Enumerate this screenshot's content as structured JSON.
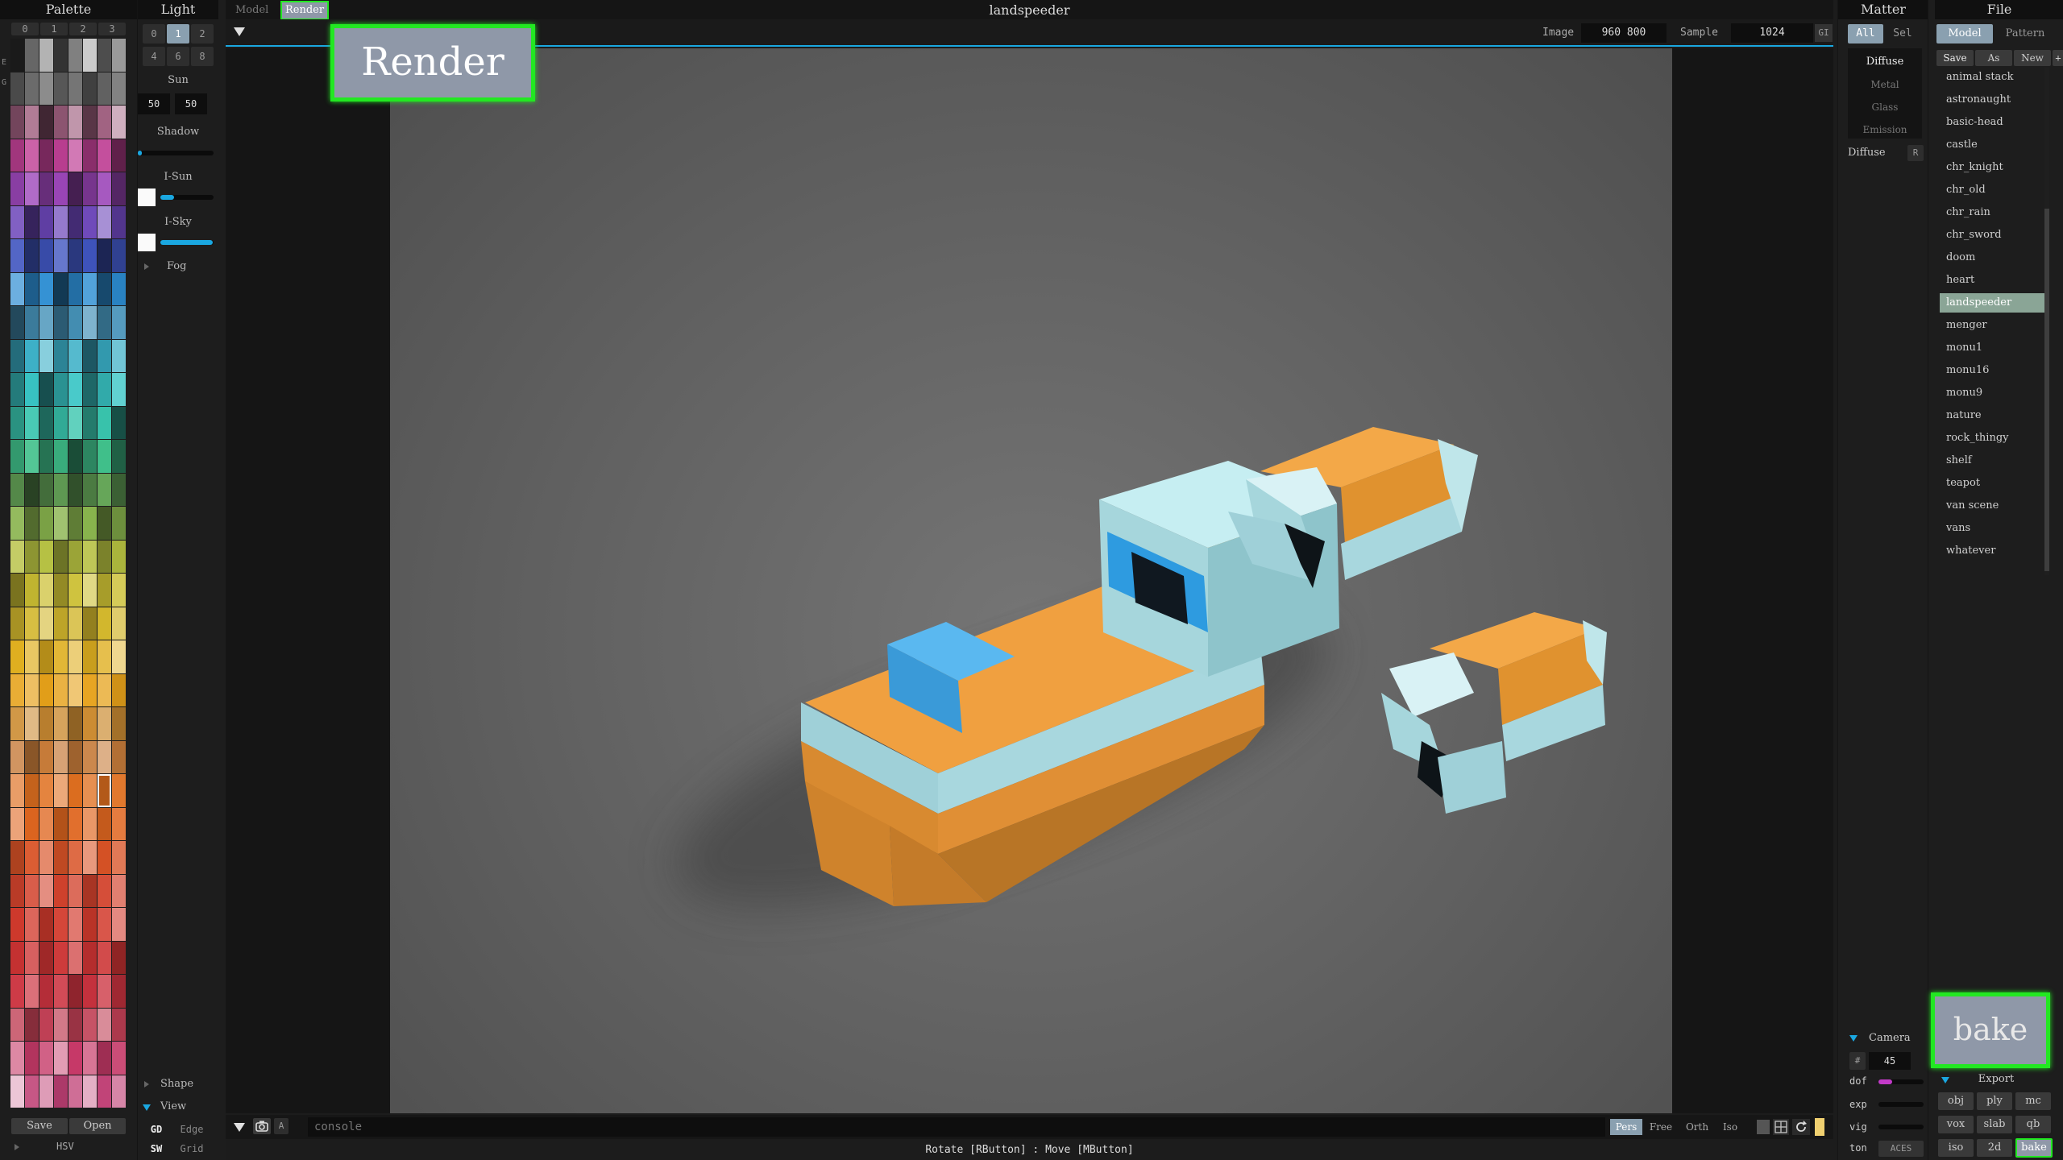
{
  "topbar": {
    "tab_model": "Model",
    "tab_render": "Render",
    "title": "landspeeder",
    "image_label": "Image",
    "image_size": "960 800",
    "sample_label": "Sample",
    "sample_value": "1024",
    "gi_label": "GI"
  },
  "palette": {
    "title": "Palette",
    "tabs": [
      "0",
      "1",
      "2",
      "3"
    ],
    "side_letters": [
      "E",
      "G"
    ],
    "save": "Save",
    "open": "Open",
    "mode": "HSV"
  },
  "light": {
    "title": "Light",
    "presets": [
      "0",
      "1",
      "2",
      "4",
      "6",
      "8"
    ],
    "sun_label": "Sun",
    "sun_values": [
      "50",
      "50"
    ],
    "shadow_label": "Shadow",
    "shadow_level": 0.05,
    "isun_label": "I-Sun",
    "isun_level": 0.25,
    "isky_label": "I-Sky",
    "isky_level": 0.98,
    "fog_label": "Fog",
    "shape_label": "Shape",
    "view_label": "View",
    "view_rows": [
      [
        "GD",
        "Edge"
      ],
      [
        "SW",
        "Grid"
      ]
    ]
  },
  "matter": {
    "title": "Matter",
    "tabs": [
      "All",
      "Sel"
    ],
    "types": [
      "Diffuse",
      "Metal",
      "Glass",
      "Emission"
    ],
    "current_label": "Diffuse",
    "current_btn": "R",
    "camera_label": "Camera",
    "camera_btn": "#",
    "camera_value": "45",
    "rows": [
      "dof",
      "exp",
      "vig",
      "ton"
    ],
    "dof_level": 0.3,
    "ton_value": "ACES"
  },
  "file": {
    "title": "File",
    "tabs": [
      "Model",
      "Pattern"
    ],
    "actions": [
      "Save",
      "As",
      "New",
      "+"
    ],
    "models": [
      "animal stack",
      "astronaught",
      "basic-head",
      "castle",
      "chr_knight",
      "chr_old",
      "chr_rain",
      "chr_sword",
      "doom",
      "heart",
      "landspeeder",
      "menger",
      "monu1",
      "monu16",
      "monu9",
      "nature",
      "rock_thingy",
      "shelf",
      "teapot",
      "van scene",
      "vans",
      "whatever"
    ],
    "selected": "landspeeder",
    "export_label": "Export",
    "export_buttons": [
      "obj",
      "ply",
      "mc",
      "vox",
      "slab",
      "qb",
      "iso",
      "2d",
      "bake"
    ]
  },
  "console": {
    "placeholder": "console",
    "a_label": "A",
    "views": [
      "Pers",
      "Free",
      "Orth",
      "Iso"
    ]
  },
  "status": "Rotate [RButton] : Move [MButton]",
  "callouts": {
    "render": "Render",
    "bake": "bake"
  },
  "colors": {
    "accent": "#1aa7e0",
    "highlight": "#22e822",
    "selection": "#8aa596",
    "body_orange": "#f0a040",
    "body_cyan": "#9fd4dd",
    "cockpit_blue": "#3fa8e8"
  }
}
